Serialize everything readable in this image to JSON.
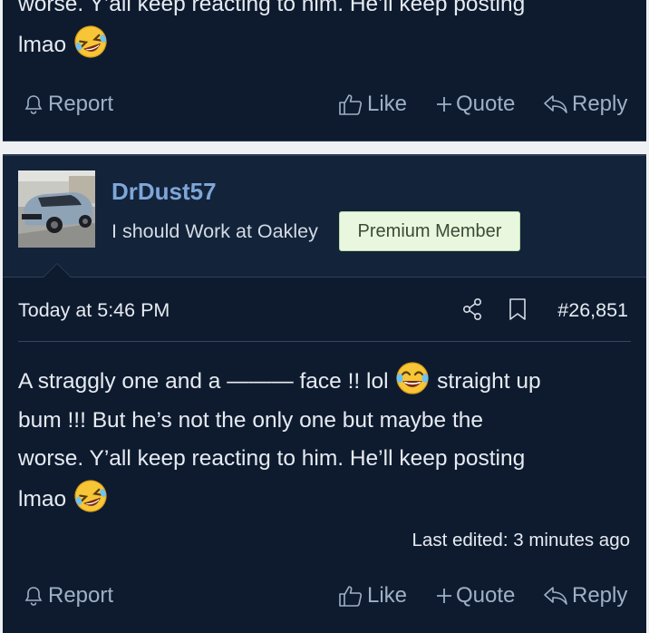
{
  "top_post": {
    "body_line1": "worse. Y’all keep reacting to him. He’ll keep posting",
    "body_line2": "lmao",
    "emoji": "rolling-on-floor-laughing-emoji",
    "actions": {
      "report": "Report",
      "like": "Like",
      "quote": "Quote",
      "reply": "Reply"
    }
  },
  "post": {
    "username": "DrDust57",
    "user_title": "I should Work at Oakley",
    "badge": "Premium Member",
    "date": "Today at 5:46 PM",
    "post_number": "#26,851",
    "body": {
      "line1_a": "A straggly one and a ——— face !! lol",
      "line1_b": "straight up",
      "line2": "bum !!! But he’s not the only one but maybe the",
      "line3": "worse. Y’all keep reacting to him. He’ll keep posting",
      "line4": "lmao"
    },
    "last_edited": "Last edited: 3 minutes ago",
    "actions": {
      "report": "Report",
      "like": "Like",
      "quote": "Quote",
      "reply": "Reply"
    }
  },
  "colors": {
    "background": "#0e1b2f",
    "header": "#13233a",
    "username": "#7fa6d8",
    "action": "#9fb0c6",
    "badge_bg": "#e9f7df"
  }
}
